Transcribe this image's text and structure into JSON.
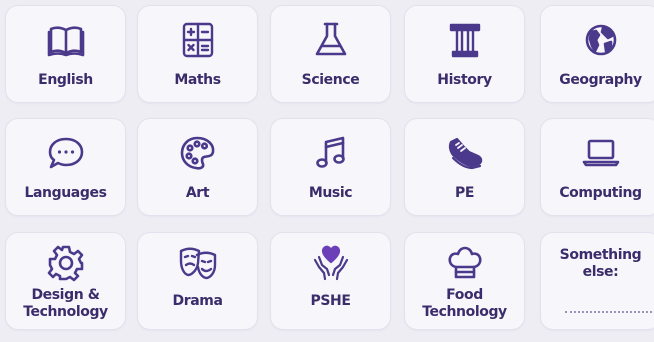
{
  "subjects": [
    {
      "label": "English",
      "icon": "book-icon"
    },
    {
      "label": "Maths",
      "icon": "calculator-icon"
    },
    {
      "label": "Science",
      "icon": "flask-icon"
    },
    {
      "label": "History",
      "icon": "column-icon"
    },
    {
      "label": "Geography",
      "icon": "globe-icon"
    },
    {
      "label": "Languages",
      "icon": "speech-bubble-icon"
    },
    {
      "label": "Art",
      "icon": "palette-icon"
    },
    {
      "label": "Music",
      "icon": "music-note-icon"
    },
    {
      "label": "PE",
      "icon": "trainer-icon"
    },
    {
      "label": "Computing",
      "icon": "laptop-icon"
    },
    {
      "label_line1": "Design &",
      "label_line2": "Technology",
      "icon": "gear-icon"
    },
    {
      "label": "Drama",
      "icon": "theatre-masks-icon"
    },
    {
      "label": "PSHE",
      "icon": "hands-heart-icon"
    },
    {
      "label_line1": "Food",
      "label_line2": "Technology",
      "icon": "chef-hat-icon"
    },
    {
      "label_line1": "Something",
      "label_line2": "else:"
    }
  ],
  "colors": {
    "icon": "#4b3a8c",
    "text": "#3b2d6b",
    "heart": "#6a3fb8",
    "background": "#efedf4",
    "tile": "#f7f6fa"
  }
}
